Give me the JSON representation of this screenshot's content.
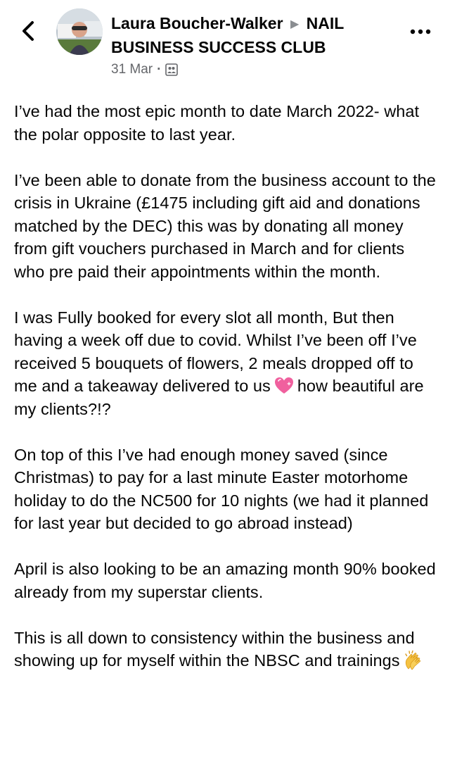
{
  "post": {
    "author": "Laura Boucher-Walker",
    "arrow_icon": "triangle-right-icon",
    "group": "NAIL BUSINESS SUCCESS CLUB",
    "date": "31 Mar",
    "separator": "·",
    "audience_icon": "group-icon",
    "paragraphs": [
      {
        "text": "I’ve had the most epic month to date March 2022- what the polar opposite to last year."
      },
      {
        "text": "I’ve been able to donate from the business account to the crisis in Ukraine (£1475 including gift aid and donations matched by the DEC) this was by donating all money from gift vouchers purchased in March and for clients who pre paid their appointments within the month."
      },
      {
        "text_before": "I was Fully booked for every slot all month, But then having a week off due to covid. Whilst I’ve been off I’ve received 5 bouquets of flowers, 2 meals dropped off to me and a takeaway delivered to us",
        "emoji": "sparkling-heart-emoji",
        "text_after": "how beautiful are my clients?!?"
      },
      {
        "text": "On top of this I’ve had enough money saved (since Christmas) to pay for a last minute Easter motorhome holiday to do the NC500 for 10 nights (we had it planned for last year but decided to go abroad instead)"
      },
      {
        "text": "April is also looking to be an amazing month 90% booked already from my superstar clients."
      },
      {
        "text_before": "This is all down to consistency within the business and showing up for myself within the NBSC and trainings",
        "emoji": "clapping-hands-emoji"
      }
    ]
  },
  "colors": {
    "text": "#050505",
    "secondary": "#65676b",
    "heart": "#f0609e"
  }
}
